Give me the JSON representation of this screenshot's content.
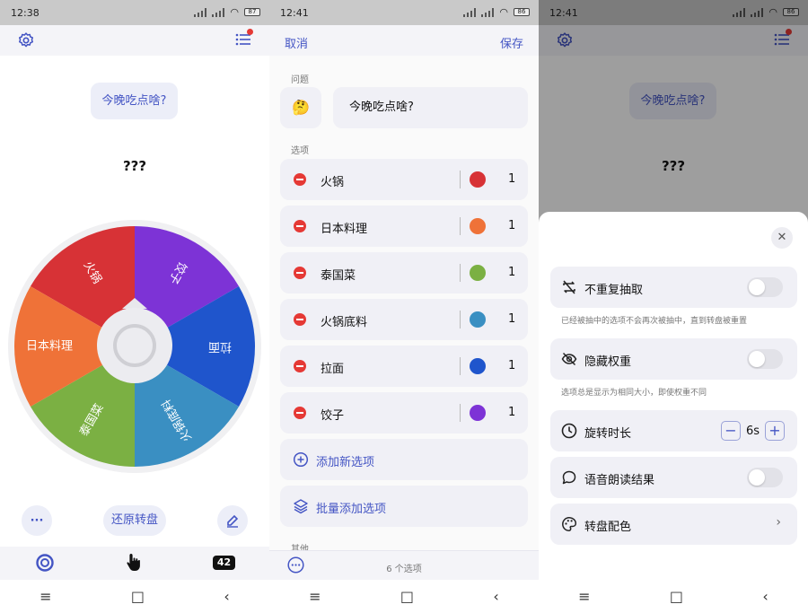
{
  "panel1": {
    "status": {
      "time": "12:38",
      "battery": "87"
    },
    "question": "今晚吃点啥?",
    "result": "???",
    "wheel_options": [
      {
        "label": "火锅",
        "color": "#d73236"
      },
      {
        "label": "饺子",
        "color": "#7d33d6"
      },
      {
        "label": "拉面",
        "color": "#1f55cc"
      },
      {
        "label": "火锅底料",
        "color": "#3a8fc2"
      },
      {
        "label": "泰国菜",
        "color": "#7bb043"
      },
      {
        "label": "日本料理",
        "color": "#ef7238"
      }
    ],
    "more_label": "···",
    "reset_label": "还原转盘",
    "counter": "42"
  },
  "panel2": {
    "status": {
      "time": "12:41",
      "battery": "86"
    },
    "cancel_label": "取消",
    "save_label": "保存",
    "question_section": "问题",
    "question_emoji": "🤔",
    "question": "今晚吃点啥?",
    "options_section": "选项",
    "options": [
      {
        "name": "火锅",
        "color": "#d73236",
        "weight": "1"
      },
      {
        "name": "日本料理",
        "color": "#ef7238",
        "weight": "1"
      },
      {
        "name": "泰国菜",
        "color": "#7bb043",
        "weight": "1"
      },
      {
        "name": "火锅底料",
        "color": "#3a8fc2",
        "weight": "1"
      },
      {
        "name": "拉面",
        "color": "#1f55cc",
        "weight": "1"
      },
      {
        "name": "饺子",
        "color": "#7d33d6",
        "weight": "1"
      }
    ],
    "add_option_label": "添加新选项",
    "bulk_add_label": "批量添加选项",
    "other_section": "其他",
    "option_count": "6 个选项"
  },
  "panel3": {
    "status": {
      "time": "12:41",
      "battery": "86"
    },
    "question": "今晚吃点啥?",
    "result": "???",
    "no_repeat_label": "不重复抽取",
    "no_repeat_hint": "已经被抽中的选项不会再次被抽中，直到转盘被重置",
    "hide_weight_label": "隐藏权重",
    "hide_weight_hint": "选项总是显示为相同大小，即使权重不同",
    "spin_duration_label": "旋转时长",
    "spin_duration_value": "6s",
    "voice_label": "语音朗读结果",
    "color_scheme_label": "转盘配色"
  },
  "nav": {
    "menu": "≡",
    "home": "□",
    "back": "‹"
  }
}
